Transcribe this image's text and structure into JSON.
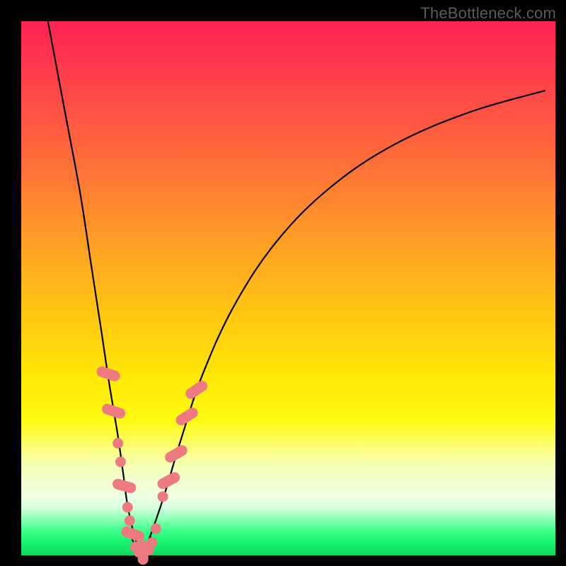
{
  "watermark": "TheBottleneck.com",
  "colors": {
    "marker": "#ed7a81",
    "curve": "#000000",
    "frame": "#000000"
  },
  "chart_data": {
    "type": "line",
    "title": "",
    "xlabel": "",
    "ylabel": "",
    "xlim": [
      0,
      100
    ],
    "ylim": [
      0,
      100
    ],
    "grid": false,
    "legend": false,
    "series": [
      {
        "name": "left-curve",
        "x": [
          5,
          8,
          11,
          13,
          15,
          16.5,
          18,
          19,
          19.8,
          20.6,
          21.4,
          22,
          22.5
        ],
        "values": [
          100,
          84,
          68,
          55,
          42,
          32,
          23,
          16,
          10,
          6,
          3,
          1.2,
          0.2
        ]
      },
      {
        "name": "right-curve",
        "x": [
          22.5,
          23.5,
          25,
          27,
          30,
          34,
          40,
          48,
          58,
          70,
          84,
          98
        ],
        "values": [
          0.2,
          2,
          6,
          12,
          22,
          34,
          47,
          59,
          69,
          77,
          83,
          87
        ]
      },
      {
        "name": "bottom-arc",
        "x": [
          20.6,
          21.4,
          22,
          22.7,
          23.4,
          24.2
        ],
        "values": [
          3.5,
          1.5,
          0.5,
          0.5,
          1.5,
          3.5
        ]
      }
    ],
    "markers_left": [
      {
        "x": 16.3,
        "y": 34,
        "kind": "pill",
        "angle": -72
      },
      {
        "x": 17.3,
        "y": 27,
        "kind": "pill",
        "angle": -72
      },
      {
        "x": 18.1,
        "y": 21,
        "kind": "round"
      },
      {
        "x": 18.6,
        "y": 17.5,
        "kind": "round"
      },
      {
        "x": 19.3,
        "y": 13,
        "kind": "pill",
        "angle": -74
      },
      {
        "x": 19.9,
        "y": 9,
        "kind": "round"
      },
      {
        "x": 20.3,
        "y": 6.5,
        "kind": "round"
      },
      {
        "x": 20.9,
        "y": 4,
        "kind": "pill",
        "angle": -70
      }
    ],
    "markers_right": [
      {
        "x": 26.5,
        "y": 11,
        "kind": "round"
      },
      {
        "x": 27.6,
        "y": 14,
        "kind": "pill",
        "angle": 62
      },
      {
        "x": 29.0,
        "y": 19,
        "kind": "pill",
        "angle": 60
      },
      {
        "x": 31.0,
        "y": 26,
        "kind": "pill",
        "angle": 58
      },
      {
        "x": 32.8,
        "y": 31,
        "kind": "pill",
        "angle": 56
      }
    ],
    "markers_bottom": [
      {
        "x": 21.4,
        "y": 1.6,
        "kind": "round"
      },
      {
        "x": 22.0,
        "y": 0.6,
        "kind": "round"
      },
      {
        "x": 22.8,
        "y": 0.5,
        "kind": "pill",
        "angle": 0
      },
      {
        "x": 23.8,
        "y": 1.0,
        "kind": "round"
      },
      {
        "x": 24.5,
        "y": 2.4,
        "kind": "round"
      },
      {
        "x": 25.2,
        "y": 5.0,
        "kind": "round"
      }
    ]
  }
}
